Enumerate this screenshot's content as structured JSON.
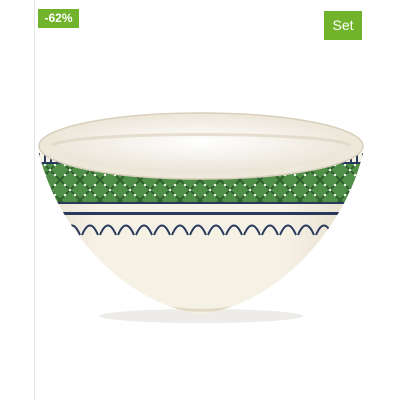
{
  "product": {
    "image_icon": "bowl-product-image",
    "discount_label": "-62%",
    "set_label": "Set"
  },
  "colors": {
    "badge_green": "#72b32c",
    "bowl_cream": "#f3efe2",
    "pattern_green": "#4f8f47",
    "pattern_navy": "#28395c"
  }
}
